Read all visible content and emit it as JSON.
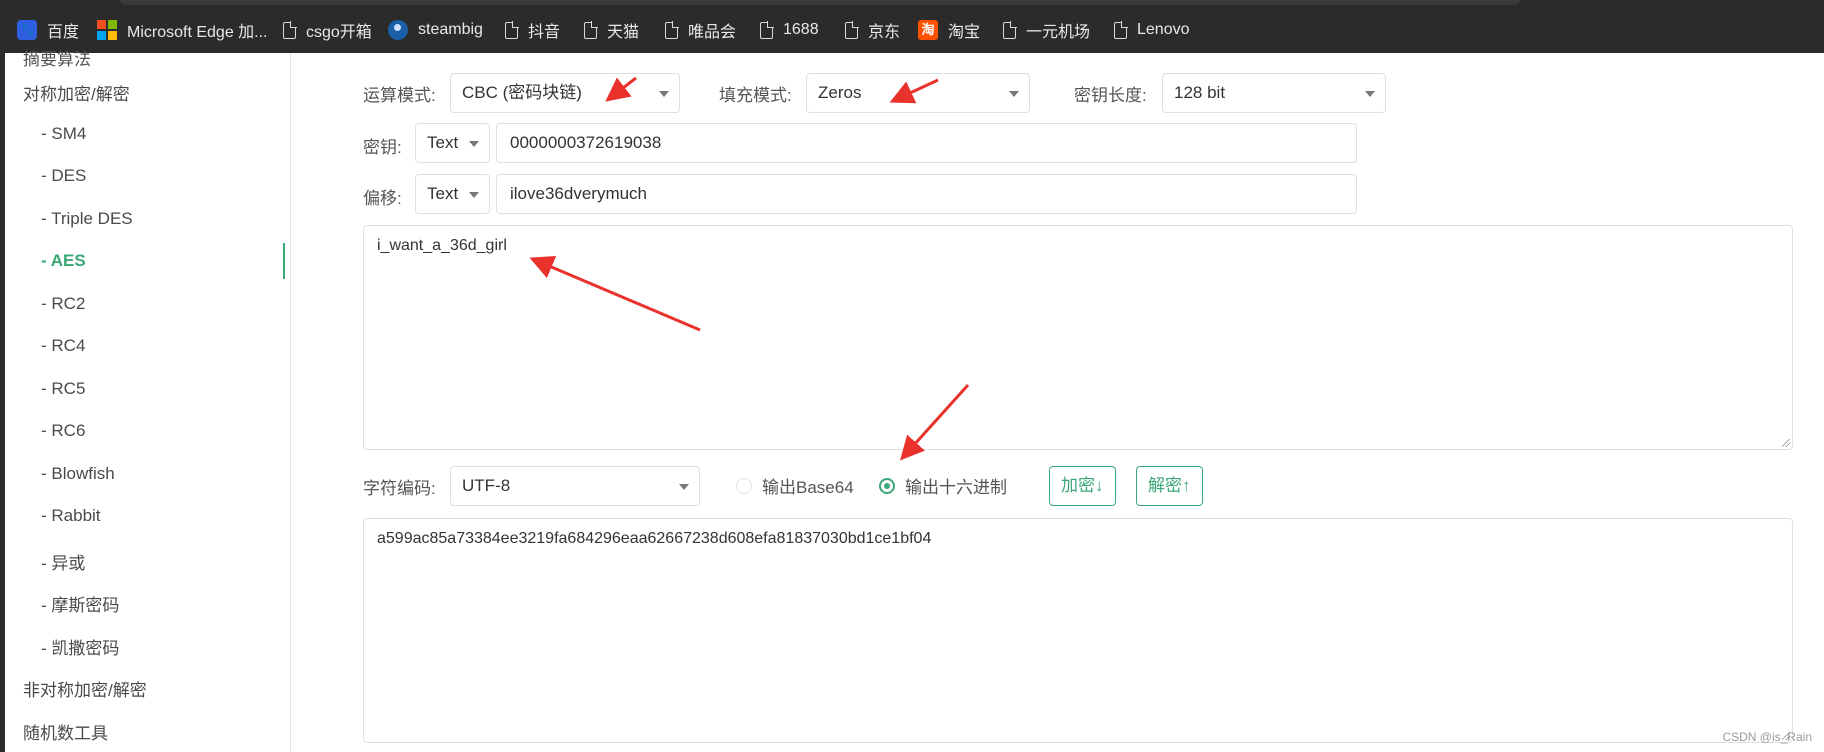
{
  "bookmarks": [
    {
      "label": "百度",
      "icon": "baidu-icon"
    },
    {
      "label": "Microsoft Edge 加...",
      "icon": "microsoft-icon"
    },
    {
      "label": "csgo开箱",
      "icon": "page-icon"
    },
    {
      "label": "steambig",
      "icon": "steam-icon"
    },
    {
      "label": "抖音",
      "icon": "page-icon"
    },
    {
      "label": "天猫",
      "icon": "page-icon"
    },
    {
      "label": "唯品会",
      "icon": "page-icon"
    },
    {
      "label": "1688",
      "icon": "page-icon"
    },
    {
      "label": "京东",
      "icon": "page-icon"
    },
    {
      "label": "淘宝",
      "icon": "taobao-icon"
    },
    {
      "label": "一元机场",
      "icon": "page-icon"
    },
    {
      "label": "Lenovo",
      "icon": "page-icon"
    }
  ],
  "sidebar": {
    "cut_top": "摘要算法",
    "category_symmetric": "对称加密/解密",
    "items": [
      "- SM4",
      "- DES",
      "- Triple DES",
      "- AES",
      "- RC2",
      "- RC4",
      "- RC5",
      "- RC6",
      "- Blowfish",
      "- Rabbit",
      "- 异或",
      "- 摩斯密码",
      "- 凯撒密码"
    ],
    "active": "- AES",
    "category_asymmetric": "非对称加密/解密",
    "category_random": "随机数工具"
  },
  "form": {
    "mode_label": "运算模式:",
    "mode_value": "CBC (密码块链)",
    "padding_label": "填充模式:",
    "padding_value": "Zeros",
    "keylen_label": "密钥长度:",
    "keylen_value": "128 bit",
    "key_label": "密钥:",
    "key_type": "Text",
    "key_value": "0000000372619038",
    "iv_label": "偏移:",
    "iv_type": "Text",
    "iv_value": "ilove36dverymuch",
    "plaintext": "i_want_a_36d_girl",
    "charset_label": "字符编码:",
    "charset_value": "UTF-8",
    "output_base64": "输出Base64",
    "output_hex": "输出十六进制",
    "output_selected": "hex",
    "encrypt_button": "加密↓",
    "decrypt_button": "解密↑",
    "output": "a599ac85a73384ee3219fa684296eaa62667238d608efa81837030bd1ce1bf04"
  },
  "colors": {
    "accent": "#3aa776",
    "annotation": "#e8322b"
  },
  "watermark": "CSDN @is_Rain"
}
